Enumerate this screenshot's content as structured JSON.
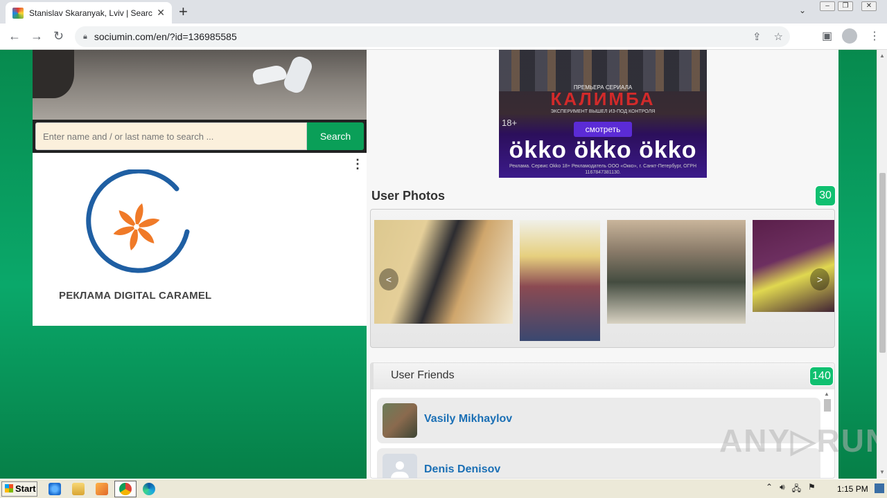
{
  "browser": {
    "tab_title": "Stanislav Skaranyak, Lviv | Search In",
    "tab_close": "✕",
    "new_tab": "+",
    "url": "sociumin.com/en/?id=136985585"
  },
  "page": {
    "search": {
      "placeholder": "Enter name and / or last name to search ...",
      "button": "Search"
    },
    "left_ad": {
      "menu_glyph": "⋮",
      "text": "РЕКЛАМА DIGITAL CARAMEL"
    },
    "okko_ad": {
      "premiere": "ПРЕМЬЕРА СЕРИАЛА",
      "title": "КАЛИМБА",
      "subtitle": "ЭКСПЕРИМЕНТ ВЫШЕЛ ИЗ-ПОД КОНТРОЛЯ",
      "age": "18+",
      "watch": "смотреть",
      "brand": "ökko ökko ökko",
      "legal": "Реклама. Сервис Okko 18+ Рекламодатель ООО «Оккo», г. Санкт-Петербург, ОГРН 1167847381130."
    },
    "photos": {
      "title": "User Photos",
      "count": "30",
      "prev": "<",
      "next": ">"
    },
    "friends": {
      "title": "User Friends",
      "count": "140",
      "items": [
        {
          "name": "Vasily Mikhaylov"
        },
        {
          "name": "Denis Denisov"
        }
      ]
    },
    "watermark": "ANY▷RUN"
  },
  "taskbar": {
    "start": "Start",
    "clock": "1:15 PM"
  }
}
